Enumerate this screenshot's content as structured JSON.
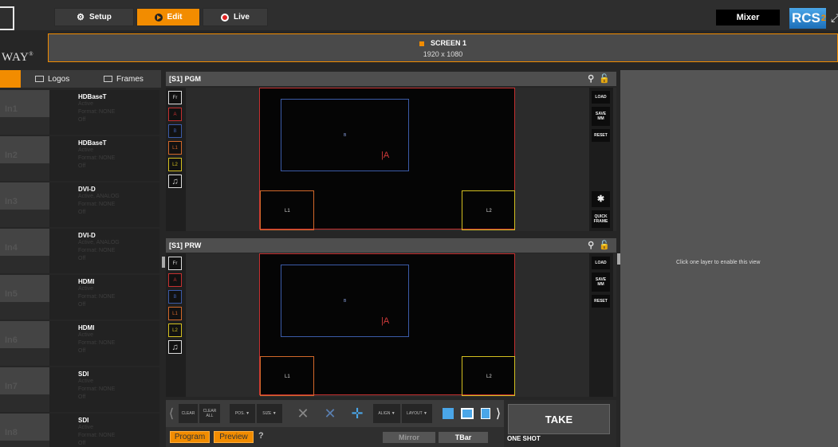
{
  "top_tabs": [
    {
      "label": "Setup",
      "icon": "gear-icon"
    },
    {
      "label": "Edit",
      "icon": "play-icon"
    },
    {
      "label": "Live",
      "icon": "record-icon"
    }
  ],
  "mode_label": "Mixer",
  "brand": {
    "logo_text": "WAY",
    "rcs_text": "RCS",
    "rcs_sup": "2"
  },
  "screen": {
    "name": "SCREEN 1",
    "resolution": "1920 x 1080"
  },
  "left_tabs": [
    {
      "label": "Logos",
      "icon": "image-icon"
    },
    {
      "label": "Frames",
      "icon": "frame-icon"
    }
  ],
  "inputs": [
    {
      "label": "In1",
      "type": "HDBaseT",
      "line1": "Active",
      "line2": "Format: NONE",
      "line3": "Off"
    },
    {
      "label": "In2",
      "type": "HDBaseT",
      "line1": "Active",
      "line2": "Format: NONE",
      "line3": "Off"
    },
    {
      "label": "In3",
      "type": "DVI-D",
      "line1": "Active, ANALOG",
      "line2": "Format: NONE",
      "line3": "Off"
    },
    {
      "label": "In4",
      "type": "DVI-D",
      "line1": "Active, ANALOG",
      "line2": "Format: NONE",
      "line3": "Off"
    },
    {
      "label": "In5",
      "type": "HDMI",
      "line1": "Active",
      "line2": "Format: NONE",
      "line3": "Off"
    },
    {
      "label": "In6",
      "type": "HDMI",
      "line1": "Active",
      "line2": "Format: NONE",
      "line3": "Off"
    },
    {
      "label": "In7",
      "type": "SDI",
      "line1": "Active",
      "line2": "Format: NONE",
      "line3": "Off"
    },
    {
      "label": "In8",
      "type": "SDI",
      "line1": "Active",
      "line2": "Format: NONE",
      "line3": "Off"
    }
  ],
  "pgm": {
    "title": "[S1] PGM"
  },
  "prw": {
    "title": "[S1] PRW"
  },
  "layer_buttons": [
    "Fr",
    "A",
    "B",
    "L1",
    "L2"
  ],
  "layer_colors": {
    "Fr": "#dddddd",
    "A": "#c53030",
    "B": "#3b5ba8",
    "L1": "#d2682a",
    "L2": "#d4c020"
  },
  "canvas_labels": {
    "b": "B",
    "a": "A",
    "l1": "L1",
    "l2": "L2"
  },
  "side_buttons": {
    "load": "LOAD",
    "save_mm": "SAVE MM",
    "reset": "RESET",
    "quick_frame": "QUICK FRAME"
  },
  "toolbar": {
    "clear": "CLEAR",
    "clear_all": "CLEAR ALL",
    "pos": "POS. ▼",
    "size": "SIZE ▼",
    "align": "ALIGN ▼",
    "layout": "LAYOUT ▼"
  },
  "bottom": {
    "program": "Program",
    "preview": "Preview",
    "help": "?",
    "mirror": "Mirror",
    "tbar": "TBar"
  },
  "take": {
    "label": "TAKE",
    "mode": "ONE SHOT"
  },
  "right_panel": {
    "message": "Click one layer to enable this view"
  },
  "accent_color": "#f28c00"
}
